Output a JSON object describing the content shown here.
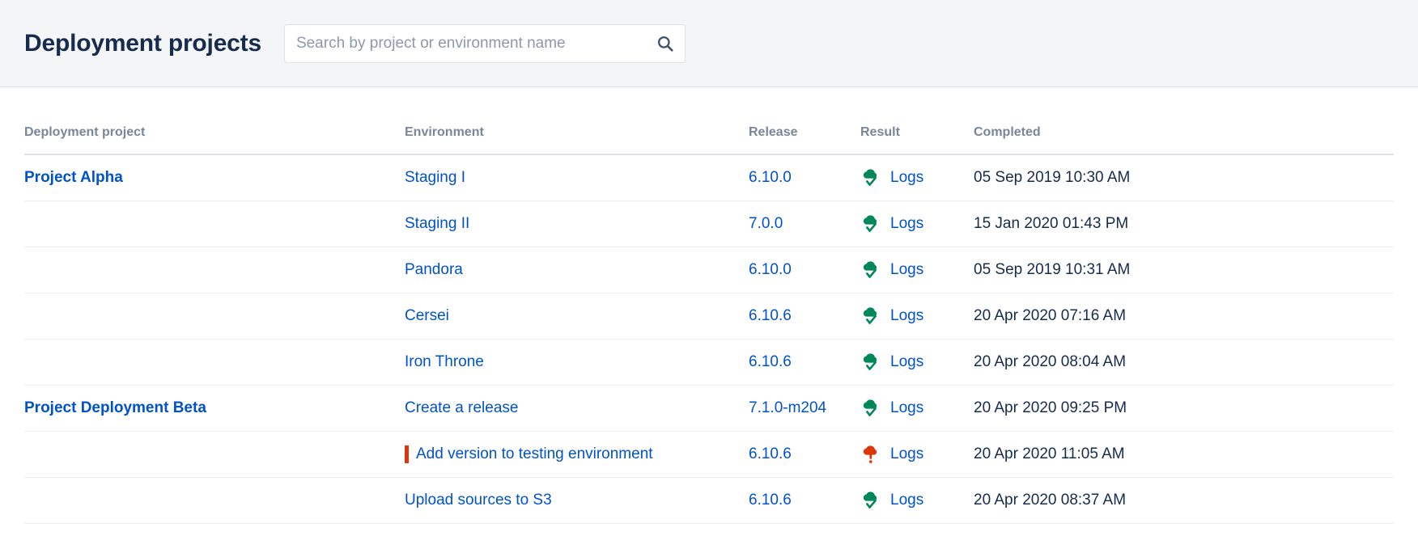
{
  "header": {
    "title": "Deployment projects",
    "search": {
      "placeholder": "Search by project or environment name",
      "value": "",
      "icon": "search-icon"
    }
  },
  "colors": {
    "header_bg": "#f4f5f7",
    "title": "#172b4d",
    "link": "#0052cc",
    "column_header": "#7a869a",
    "success": "#00875a",
    "failure": "#de350b",
    "text": "#172b4d"
  },
  "table": {
    "columns": [
      {
        "key": "project",
        "label": "Deployment project"
      },
      {
        "key": "environment",
        "label": "Environment"
      },
      {
        "key": "release",
        "label": "Release"
      },
      {
        "key": "result",
        "label": "Result"
      },
      {
        "key": "completed",
        "label": "Completed"
      }
    ],
    "logs_label": "Logs",
    "rows": [
      {
        "project": "Project Alpha",
        "group_start": true,
        "environment": "Staging I",
        "release": "6.10.0",
        "result": "success",
        "result_icon": "cloud-check-icon",
        "logs": "Logs",
        "completed": "05 Sep 2019 10:30 AM"
      },
      {
        "project": "",
        "group_start": false,
        "environment": "Staging II",
        "release": "7.0.0",
        "result": "success",
        "result_icon": "cloud-check-icon",
        "logs": "Logs",
        "completed": "15 Jan 2020 01:43 PM"
      },
      {
        "project": "",
        "group_start": false,
        "environment": "Pandora",
        "release": "6.10.0",
        "result": "success",
        "result_icon": "cloud-check-icon",
        "logs": "Logs",
        "completed": "05 Sep 2019 10:31 AM"
      },
      {
        "project": "",
        "group_start": false,
        "environment": "Cersei",
        "release": "6.10.6",
        "result": "success",
        "result_icon": "cloud-check-icon",
        "logs": "Logs",
        "completed": "20 Apr 2020 07:16 AM"
      },
      {
        "project": "",
        "group_start": false,
        "environment": "Iron Throne",
        "release": "6.10.6",
        "result": "success",
        "result_icon": "cloud-check-icon",
        "logs": "Logs",
        "completed": "20 Apr 2020 08:04 AM"
      },
      {
        "project": "Project Deployment Beta",
        "group_start": true,
        "environment": "Create a release",
        "release": "7.1.0-m204",
        "result": "success",
        "result_icon": "cloud-check-icon",
        "logs": "Logs",
        "completed": "20 Apr 2020 09:25 PM"
      },
      {
        "project": "",
        "group_start": false,
        "environment": "Add version to testing environment",
        "release": "6.10.6",
        "result": "failure",
        "result_icon": "cloud-alert-icon",
        "logs": "Logs",
        "completed": "20 Apr 2020 11:05 AM"
      },
      {
        "project": "",
        "group_start": false,
        "environment": "Upload sources to S3",
        "release": "6.10.6",
        "result": "success",
        "result_icon": "cloud-check-icon",
        "logs": "Logs",
        "completed": "20 Apr 2020 08:37 AM"
      }
    ]
  }
}
